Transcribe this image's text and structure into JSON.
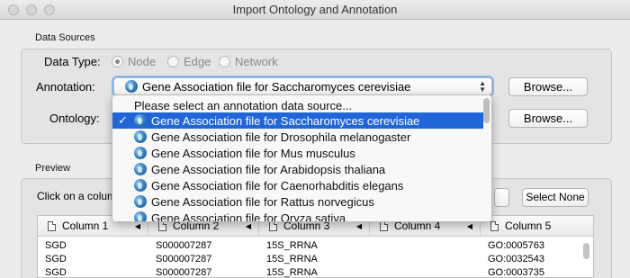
{
  "window": {
    "title": "Import Ontology and Annotation"
  },
  "data_sources": {
    "section_label": "Data Sources",
    "data_type_label": "Data Type:",
    "data_type_options": [
      "Node",
      "Edge",
      "Network"
    ],
    "selected_data_type": "Node",
    "annotation_label": "Annotation:",
    "annotation_value": "Gene Association file for Saccharomyces cerevisiae",
    "ontology_label": "Ontology:",
    "browse_label": "Browse..."
  },
  "dropdown": {
    "placeholder": "Please select an annotation data source...",
    "items": [
      "Gene Association file for Saccharomyces cerevisiae",
      "Gene Association file for Drosophila melanogaster",
      "Gene Association file for Mus musculus",
      "Gene Association file for Arabidopsis thaliana",
      "Gene Association file for Caenorhabditis elegans",
      "Gene Association file for Rattus norvegicus",
      "Gene Association file for Oryza sativa"
    ],
    "selected_index": 0,
    "checkmark": "✓"
  },
  "preview": {
    "section_label": "Preview",
    "hint": "Click on a colum",
    "select_none_label": "Select None",
    "columns": [
      "Column 1",
      "Column 2",
      "Column 3",
      "Column 4",
      "Column 5"
    ],
    "rows": [
      [
        "SGD",
        "S000007287",
        "15S_RRNA",
        "",
        "GO:0005763"
      ],
      [
        "SGD",
        "S000007287",
        "15S_RRNA",
        "",
        "GO:0032543"
      ],
      [
        "SGD",
        "S000007287",
        "15S_RRNA",
        "",
        "GO:0003735"
      ]
    ]
  }
}
